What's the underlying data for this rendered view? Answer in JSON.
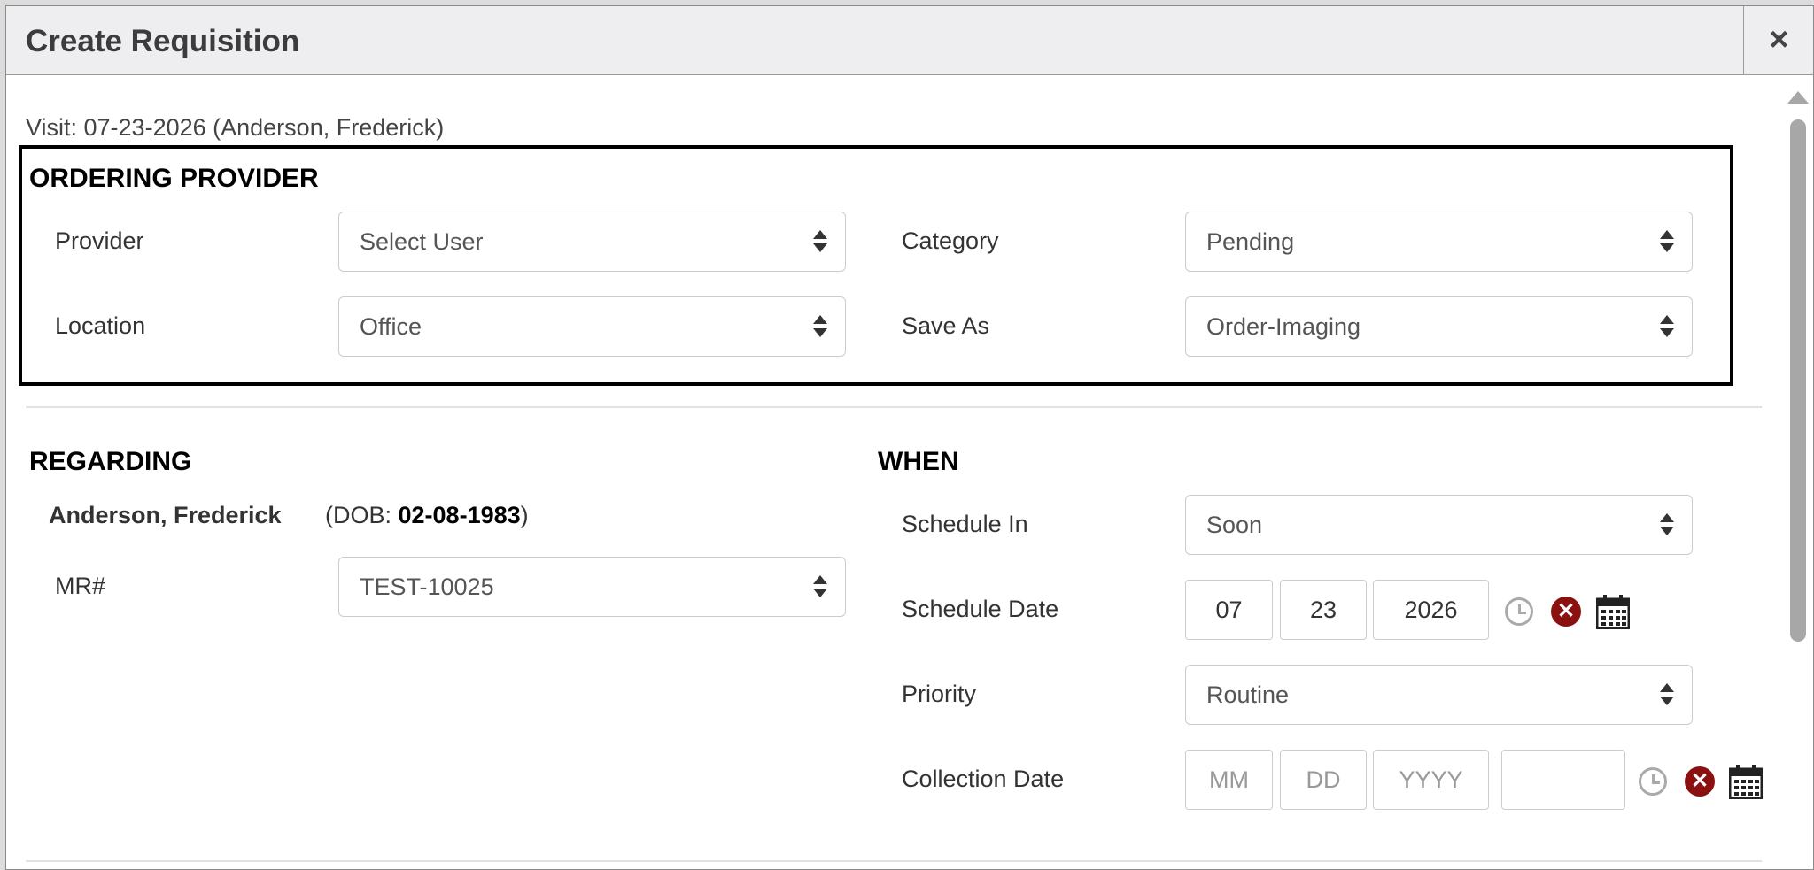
{
  "dialog": {
    "title": "Create Requisition",
    "close_label": "×"
  },
  "visit": "Visit: 07-23-2026 (Anderson, Frederick)",
  "ordering_provider": {
    "title": "ORDERING PROVIDER",
    "provider_label": "Provider",
    "provider_value": "Select User",
    "location_label": "Location",
    "location_value": "Office",
    "category_label": "Category",
    "category_value": "Pending",
    "save_as_label": "Save As",
    "save_as_value": "Order-Imaging"
  },
  "regarding": {
    "title": "REGARDING",
    "patient_name": "Anderson, Frederick",
    "dob_prefix": "(DOB: ",
    "dob_value": "02-08-1983",
    "dob_suffix": ")",
    "mr_label": "MR#",
    "mr_value": "TEST-10025"
  },
  "when": {
    "title": "WHEN",
    "schedule_in_label": "Schedule In",
    "schedule_in_value": "Soon",
    "schedule_date_label": "Schedule Date",
    "schedule_month": "07",
    "schedule_day": "23",
    "schedule_year": "2026",
    "priority_label": "Priority",
    "priority_value": "Routine",
    "collection_date_label": "Collection Date",
    "collection_month_placeholder": "MM",
    "collection_day_placeholder": "DD",
    "collection_year_placeholder": "YYYY",
    "collection_time_placeholder": ""
  },
  "icons": {
    "close": "close-icon",
    "clock": "clock-icon",
    "clear": "clear-icon",
    "calendar": "calendar-icon",
    "select_caret": "chevron-up-down-icon"
  },
  "colors": {
    "header_bg": "#eeeef1",
    "clear_icon": "#8b1111",
    "box_border": "#000000"
  }
}
